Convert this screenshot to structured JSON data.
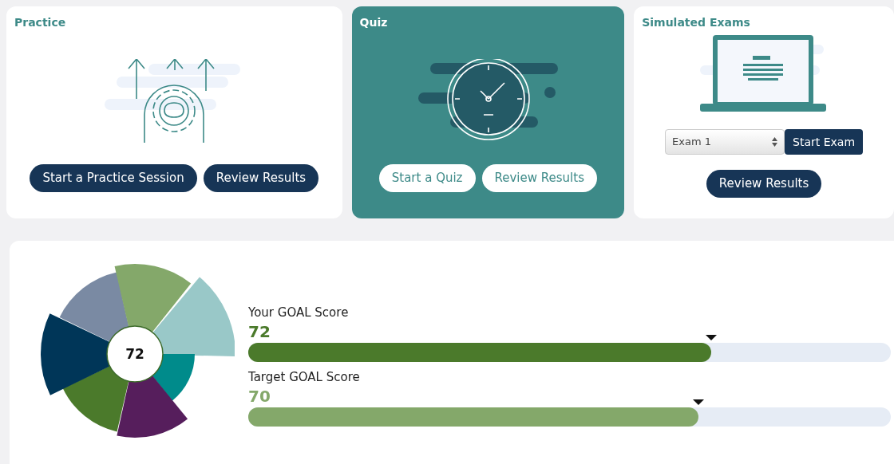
{
  "cards": [
    {
      "title": "Practice",
      "selected": false,
      "kind": "practice",
      "buttons": [
        "Start a Practice Session",
        "Review Results"
      ]
    },
    {
      "title": "Quiz",
      "selected": true,
      "kind": "quiz",
      "buttons": [
        "Start a Quiz",
        "Review Results"
      ]
    },
    {
      "title": "Simulated Exams",
      "selected": false,
      "kind": "exam",
      "exam_select": {
        "value": "Exam 1"
      },
      "start_button": "Start Exam",
      "buttons": [
        "Review Results"
      ]
    }
  ],
  "score_panel": {
    "center_label": "72",
    "scores": [
      {
        "label": "Your GOAL Score",
        "value": "72",
        "level": 0.72,
        "color": "#4b7a2b"
      },
      {
        "label": "Target GOAL Score",
        "value": "70",
        "level": 0.7,
        "color": "#84a86a"
      }
    ]
  }
}
